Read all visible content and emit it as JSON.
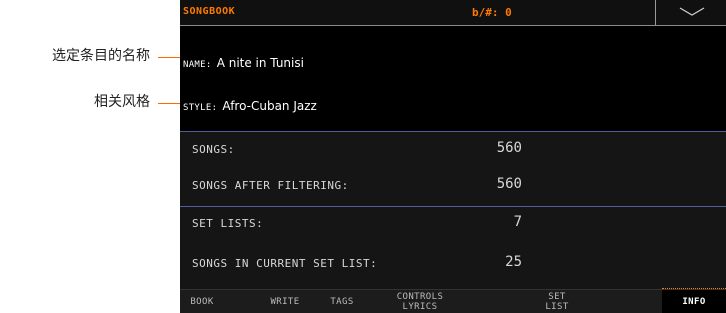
{
  "annotations": {
    "selected_name": "选定条目的名称",
    "related_style": "相关风格",
    "line_color": "#ff6a00"
  },
  "header": {
    "title": "SONGBOOK",
    "key_label": "b/#: 0",
    "dropdown_icon": "chevron-down-icon",
    "accent_color": "#ff7a00"
  },
  "info": {
    "name_label": "NAME:",
    "name_value": "A nite in Tunisi",
    "style_label": "STYLE:",
    "style_value": "Afro-Cuban Jazz"
  },
  "stats": {
    "songs_label": "SONGS:",
    "songs_value": "560",
    "songs_after_filtering_label": "SONGS AFTER FILTERING:",
    "songs_after_filtering_value": "560",
    "set_lists_label": "SET LISTS:",
    "set_lists_value": "7",
    "songs_in_set_list_label": "SONGS IN CURRENT SET LIST:",
    "songs_in_set_list_value": "25"
  },
  "tabs": {
    "book": "BOOK",
    "write": "WRITE",
    "tags": "TAGS",
    "controls": "CONTROLS",
    "lyrics": "LYRICS",
    "set": "SET",
    "list": "LIST",
    "info": "INFO",
    "active": "INFO"
  }
}
